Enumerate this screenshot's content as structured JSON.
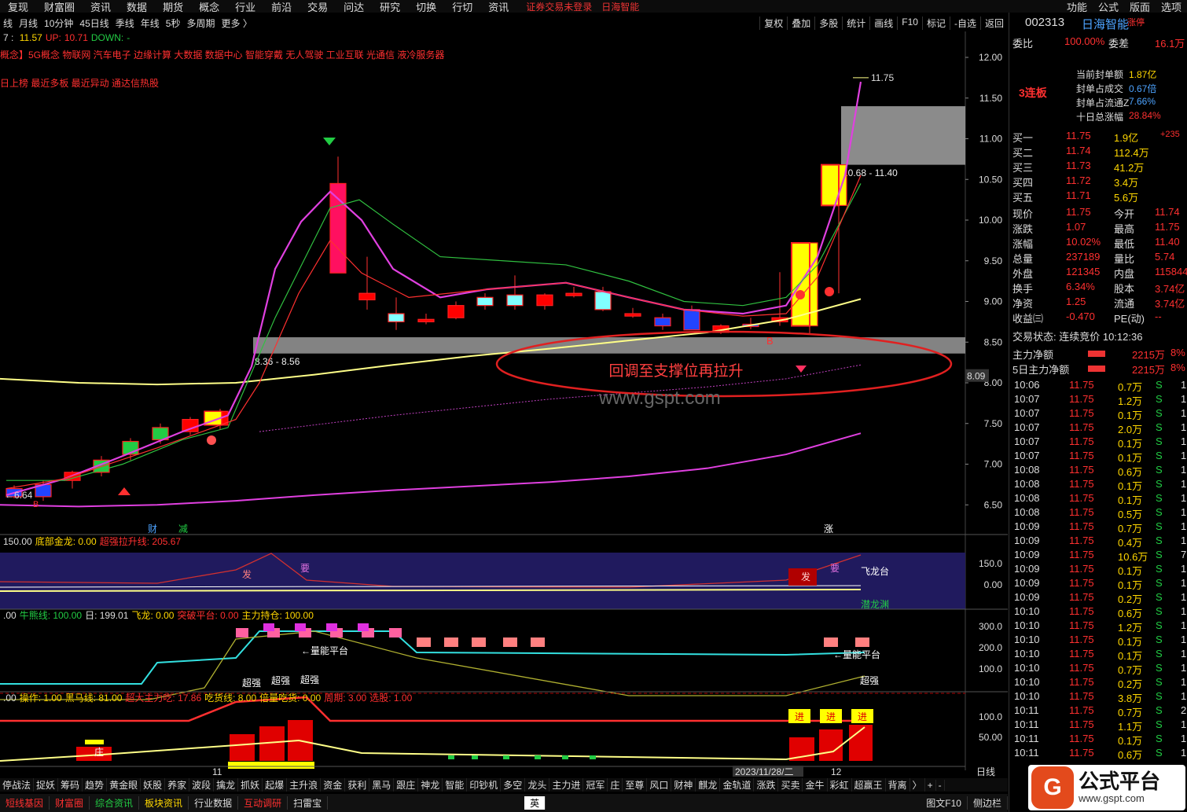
{
  "menu": {
    "items": [
      "复现",
      "财富圈",
      "资讯",
      "数据",
      "期货",
      "概念",
      "行业",
      "前沿",
      "交易",
      "问达",
      "研究",
      "切换",
      "行切",
      "资讯"
    ],
    "warning": "证券交易未登录",
    "stock_name_top": "日海智能",
    "right": [
      "功能",
      "公式",
      "版面",
      "选项"
    ]
  },
  "toolbar": {
    "left": [
      "线",
      "月线",
      "10分钟",
      "45日线",
      "季线",
      "年线",
      "5秒",
      "多周期",
      "更多 〉"
    ],
    "right": [
      "复权",
      "叠加",
      "多股",
      "统计",
      "画线",
      "F10",
      "标记",
      "-自选",
      "返回"
    ]
  },
  "chart": {
    "info1": {
      "prefix": "7 : ",
      "v1": "11.57",
      "up_label": "UP:",
      "up": "10.71",
      "down_label": "DOWN:",
      "down": "-"
    },
    "concepts": "概念】5G概念 物联网 汽车电子 边缘计算 大数据 数据中心 智能穿戴 无人驾驶 工业互联 光通信 液冷服务器",
    "tags": "日上榜 最近多板 最近异动 通达信热股",
    "y_ticks": [
      "12.00",
      "11.50",
      "11.00",
      "10.50",
      "10.00",
      "9.50",
      "9.00",
      "8.50",
      "8.00",
      "7.50",
      "7.00",
      "6.50"
    ],
    "price_box": "8.09",
    "support_label": "8.36 - 8.56",
    "resistance_label": "10.68 - 11.40",
    "high_label": "11.75",
    "low_label": "←6.64",
    "annotation": "回调至支撑位再拉升",
    "watermark": "www.gspt.com",
    "marks": {
      "cai": "财",
      "jian": "减",
      "zhang": "涨",
      "b": "B"
    }
  },
  "panel1": {
    "legend_a": "150.00",
    "legend_b": "底部金龙: 0.00",
    "legend_c": "超强拉升线: 205.67",
    "y": [
      "150.0",
      "0.00"
    ],
    "labels": {
      "fa": "发",
      "yao": "要",
      "feilong": "飞龙台",
      "qianlong": "潜龙渊"
    }
  },
  "panel2": {
    "legend_a": ".00",
    "legend_b": "牛熊线: 100.00",
    "legend_c": "日: 199.01",
    "legend_d": "飞龙: 0.00",
    "legend_e": "突破平台: 0.00",
    "legend_f": "主力持仓: 100.00",
    "y": [
      "300.0",
      "200.0",
      "100.0"
    ],
    "labels": {
      "lnpt": "←量能平台",
      "cq": "超强"
    }
  },
  "panel3": {
    "legend_a": ".00",
    "legend_b": "操作: 1.00",
    "legend_c": "黑马线: 81.00",
    "legend_d": "超大主力吃: 17.86",
    "legend_e": "吃货线: 8.00",
    "legend_f": "倍量吃货: 0.00",
    "legend_g": "周期: 3.00",
    "legend_h": "选股: 1.00",
    "y": [
      "100.0",
      "50.00"
    ],
    "labels": {
      "zhuang": "庄",
      "jin": "进"
    }
  },
  "xaxis": {
    "d1": "11",
    "date": "2023/11/28/二",
    "d2": "12",
    "period": "日线"
  },
  "right": {
    "code": "002313",
    "name": "日海智能",
    "tag": "涨停",
    "weibi_l": "委比",
    "weibi": "100.00%",
    "weicha_l": "委差",
    "weicha": "16.1万",
    "seal_amt_l": "当前封单额",
    "seal_amt": "1.87亿",
    "seal_ratio_l": "封单占成交",
    "seal_ratio": "0.67倍",
    "seal_float_l": "封单占流通Z",
    "seal_float": "7.66%",
    "ten_day_l": "十日总涨幅",
    "ten_day": "28.84%",
    "streak": "3连板",
    "bids": [
      {
        "l": "买一",
        "p": "11.75",
        "v": "1.9亿",
        "c": "+235"
      },
      {
        "l": "买二",
        "p": "11.74",
        "v": "112.4万",
        "c": ""
      },
      {
        "l": "买三",
        "p": "11.73",
        "v": "41.2万",
        "c": ""
      },
      {
        "l": "买四",
        "p": "11.72",
        "v": "3.4万",
        "c": ""
      },
      {
        "l": "买五",
        "p": "11.71",
        "v": "5.6万",
        "c": ""
      }
    ],
    "quote": [
      {
        "l1": "现价",
        "v1": "11.75",
        "l2": "今开",
        "v2": "11.74"
      },
      {
        "l1": "涨跌",
        "v1": "1.07",
        "l2": "最高",
        "v2": "11.75"
      },
      {
        "l1": "涨幅",
        "v1": "10.02%",
        "l2": "最低",
        "v2": "11.40"
      },
      {
        "l1": "总量",
        "v1": "237189",
        "l2": "量比",
        "v2": "5.74"
      },
      {
        "l1": "外盘",
        "v1": "121345",
        "l2": "内盘",
        "v2": "115844"
      },
      {
        "l1": "换手",
        "v1": "6.34%",
        "l2": "股本",
        "v2": "3.74亿"
      },
      {
        "l1": "净资",
        "v1": "1.25",
        "l2": "流通",
        "v2": "3.74亿"
      },
      {
        "l1": "收益㈢",
        "v1": "-0.470",
        "l2": "PE(动)",
        "v2": "--"
      }
    ],
    "trade_state": "交易状态: 连续竞价 10:12:36",
    "flow1_l": "主力净额",
    "flow1": "2215万",
    "flow1_p": "8%",
    "flow2_l": "5日主力净额",
    "flow2": "2215万",
    "flow2_p": "8%",
    "ticks": [
      [
        "10:06",
        "11.75",
        "0.7万",
        "S",
        "1"
      ],
      [
        "10:07",
        "11.75",
        "1.2万",
        "S",
        "1"
      ],
      [
        "10:07",
        "11.75",
        "0.1万",
        "S",
        "1"
      ],
      [
        "10:07",
        "11.75",
        "2.0万",
        "S",
        "1"
      ],
      [
        "10:07",
        "11.75",
        "0.1万",
        "S",
        "1"
      ],
      [
        "10:07",
        "11.75",
        "0.1万",
        "S",
        "1"
      ],
      [
        "10:08",
        "11.75",
        "0.6万",
        "S",
        "1"
      ],
      [
        "10:08",
        "11.75",
        "0.1万",
        "S",
        "1"
      ],
      [
        "10:08",
        "11.75",
        "0.1万",
        "S",
        "1"
      ],
      [
        "10:08",
        "11.75",
        "0.5万",
        "S",
        "1"
      ],
      [
        "10:09",
        "11.75",
        "0.7万",
        "S",
        "1"
      ],
      [
        "10:09",
        "11.75",
        "0.4万",
        "S",
        "1"
      ],
      [
        "10:09",
        "11.75",
        "10.6万",
        "S",
        "7"
      ],
      [
        "10:09",
        "11.75",
        "0.1万",
        "S",
        "1"
      ],
      [
        "10:09",
        "11.75",
        "0.1万",
        "S",
        "1"
      ],
      [
        "10:09",
        "11.75",
        "0.2万",
        "S",
        "1"
      ],
      [
        "10:10",
        "11.75",
        "0.6万",
        "S",
        "1"
      ],
      [
        "10:10",
        "11.75",
        "1.2万",
        "S",
        "1"
      ],
      [
        "10:10",
        "11.75",
        "0.1万",
        "S",
        "1"
      ],
      [
        "10:10",
        "11.75",
        "0.1万",
        "S",
        "1"
      ],
      [
        "10:10",
        "11.75",
        "0.7万",
        "S",
        "1"
      ],
      [
        "10:10",
        "11.75",
        "0.2万",
        "S",
        "1"
      ],
      [
        "10:10",
        "11.75",
        "3.8万",
        "S",
        "1"
      ],
      [
        "10:11",
        "11.75",
        "0.7万",
        "S",
        "2"
      ],
      [
        "10:11",
        "11.75",
        "1.1万",
        "S",
        "1"
      ],
      [
        "10:11",
        "11.75",
        "0.1万",
        "S",
        "1"
      ],
      [
        "10:11",
        "11.75",
        "0.6万",
        "S",
        "1"
      ]
    ]
  },
  "bottom": {
    "items": [
      "停战法",
      "捉妖",
      "筹码",
      "趋势",
      "黄金眼",
      "妖股",
      "养家",
      "波段",
      "擒龙",
      "抓妖",
      "起爆",
      "主升浪",
      "资金",
      "获利",
      "黑马",
      "跟庄",
      "神龙",
      "智能",
      "印钞机",
      "多空",
      "龙头",
      "主力进",
      "冠军",
      "庄",
      "至尊",
      "风口",
      "财神",
      "麒龙",
      "金轨道",
      "涨跌",
      "买卖",
      "金牛",
      "彩虹",
      "超赢王",
      "背离",
      "〉"
    ],
    "plus": "+",
    "minus": "-"
  },
  "tabs": {
    "items": [
      "短线基因",
      "财富圈",
      "综合资讯",
      "板块资讯",
      "行业数据",
      "互动调研",
      "扫雷宝"
    ],
    "ime": "英",
    "right1": "图文F10",
    "right2": "侧边栏"
  },
  "logo": {
    "title": "公式平台",
    "url": "www.gspt.com"
  }
}
